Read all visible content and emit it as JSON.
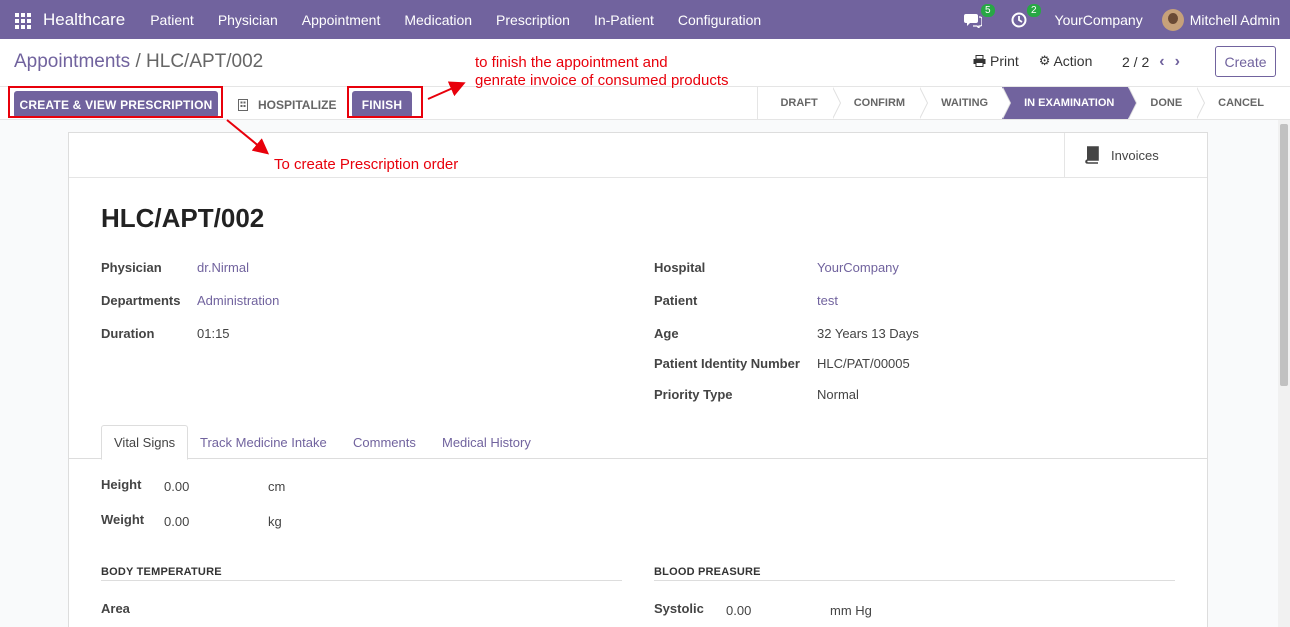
{
  "navbar": {
    "brand": "Healthcare",
    "menu": [
      "Patient",
      "Physician",
      "Appointment",
      "Medication",
      "Prescription",
      "In-Patient",
      "Configuration"
    ],
    "chat_badge": "5",
    "activity_badge": "2",
    "company": "YourCompany",
    "user": "Mitchell Admin"
  },
  "control_panel": {
    "breadcrumb_parent": "Appointments",
    "breadcrumb_separator": " / ",
    "breadcrumb_current": "HLC/APT/002",
    "print_label": "Print",
    "action_label": "Action",
    "pager": "2 / 2",
    "create_label": "Create"
  },
  "statusbar": {
    "create_prescription_label": "CREATE & VIEW PRESCRIPTION",
    "hospitalize_label": "HOSPITALIZE",
    "finish_label": "FINISH",
    "stages": [
      "DRAFT",
      "CONFIRM",
      "WAITING",
      "IN EXAMINATION",
      "DONE",
      "CANCEL"
    ],
    "active_stage": "IN EXAMINATION"
  },
  "annotations": {
    "finish_note_line1": "to finish the appointment and",
    "finish_note_line2": "genrate invoice of consumed products",
    "prescription_note": "To create Prescription order"
  },
  "form": {
    "invoices_label": "Invoices",
    "title": "HLC/APT/002",
    "left_fields": {
      "physician_label": "Physician",
      "physician": "dr.Nirmal",
      "departments_label": "Departments",
      "departments": "Administration",
      "duration_label": "Duration",
      "duration": "01:15"
    },
    "right_fields": {
      "hospital_label": "Hospital",
      "hospital": "YourCompany",
      "patient_label": "Patient",
      "patient": "test",
      "age_label": "Age",
      "age": "32 Years 13 Days",
      "pin_label": "Patient Identity Number",
      "pin": "HLC/PAT/00005",
      "priority_label": "Priority Type",
      "priority": "Normal"
    },
    "tabs": [
      "Vital Signs",
      "Track Medicine Intake",
      "Comments",
      "Medical History"
    ],
    "vitals": {
      "height_label": "Height",
      "height": "0.00",
      "height_unit": "cm",
      "weight_label": "Weight",
      "weight": "0.00",
      "weight_unit": "kg",
      "body_temp_head": "BODY TEMPERATURE",
      "blood_pressure_head": "BLOOD PREASURE",
      "area_label": "Area",
      "systolic_label": "Systolic",
      "systolic": "0.00",
      "systolic_unit": "mm Hg"
    }
  },
  "colors": {
    "brand": "#71639e",
    "annotation": "#e8000b",
    "badge": "#28a745"
  },
  "icons": [
    "apps-grid-icon",
    "chat-icon",
    "clock-icon",
    "print-icon",
    "gear-icon",
    "chevron-left-icon",
    "chevron-right-icon",
    "building-icon",
    "book-icon"
  ]
}
